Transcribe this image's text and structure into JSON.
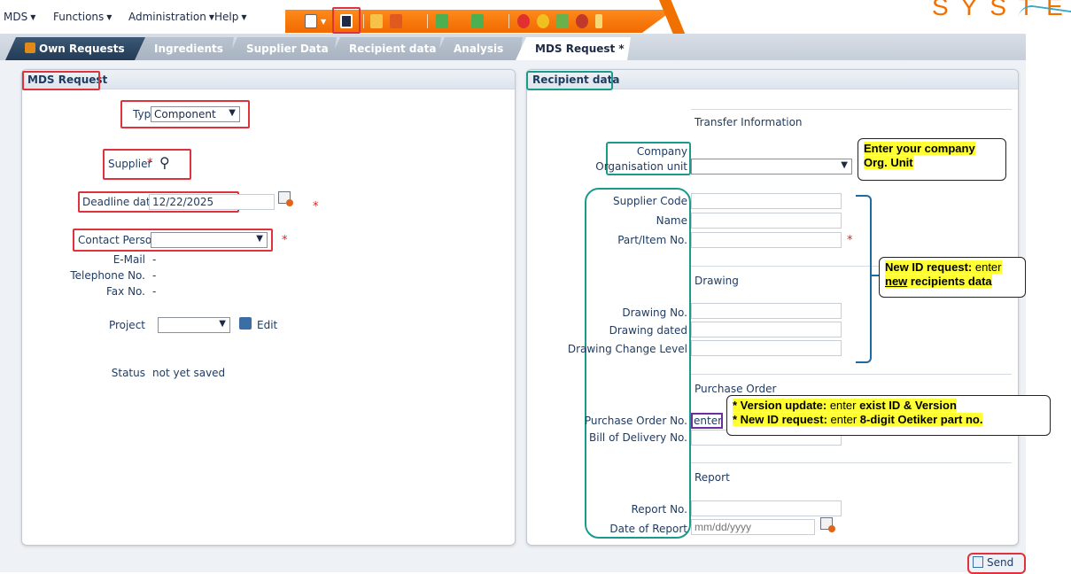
{
  "menu": [
    {
      "label": "MDS"
    },
    {
      "label": "Functions"
    },
    {
      "label": "Administration"
    },
    {
      "label": "Help"
    }
  ],
  "brand_text": "SYSTE",
  "tabs": [
    {
      "label": "Own Requests",
      "state": "dark"
    },
    {
      "label": "Ingredients",
      "state": "disabled"
    },
    {
      "label": "Supplier Data",
      "state": "disabled"
    },
    {
      "label": "Recipient data",
      "state": "disabled"
    },
    {
      "label": "Analysis",
      "state": "disabled"
    },
    {
      "label": "MDS Request *",
      "state": "active"
    }
  ],
  "left_panel": {
    "title": "MDS Request",
    "type_label": "Type",
    "type_value": "Component",
    "supplier_label": "Supplier",
    "deadline_label": "Deadline date",
    "deadline_value": "12/22/2025",
    "contact_label": "Contact Person",
    "contact_value": "",
    "email_label": "E-Mail",
    "email_value": "-",
    "phone_label": "Telephone No.",
    "phone_value": "-",
    "fax_label": "Fax No.",
    "fax_value": "-",
    "project_label": "Project",
    "project_value": "",
    "edit_label": "Edit",
    "status_label": "Status",
    "status_value": "not yet saved",
    "required_mark": "*"
  },
  "right_panel": {
    "title": "Recipient data",
    "transfer_heading": "Transfer Information",
    "company_label": "Company",
    "org_unit_label": "Organisation unit",
    "org_unit_value": "",
    "supplier_code_label": "Supplier Code",
    "name_label": "Name",
    "part_no_label": "Part/Item No.",
    "drawing_heading": "Drawing",
    "drawing_no_label": "Drawing No.",
    "drawing_dated_label": "Drawing dated",
    "drawing_change_label": "Drawing Change Level",
    "purchase_heading": "Purchase Order",
    "po_no_label": "Purchase Order No.",
    "po_no_value": "enter*",
    "bill_label": "Bill of Delivery No.",
    "report_heading": "Report",
    "report_no_label": "Report No.",
    "report_date_label": "Date of Report",
    "report_date_placeholder": "mm/dd/yyyy",
    "required_mark": "*"
  },
  "callouts": {
    "company": {
      "line1": "Enter your company",
      "line2": "Org. Unit"
    },
    "new_id": {
      "bold": "New ID request:",
      "rest": " enter",
      "underlined": "new",
      "line2_rest": " recipients data"
    },
    "po": {
      "l1_star": "* ",
      "l1_bold": "Version update:",
      "l1_mid": " enter ",
      "l1_bold2": "exist ID & Version",
      "l2_star": "* ",
      "l2_bold": "New ID request:",
      "l2_mid": " enter ",
      "l2_bold2": "8-digit Oetiker part no."
    }
  },
  "send_label": "Send",
  "colors": {
    "accent_orange": "#f07000",
    "annotation_red": "#e0323c",
    "annotation_teal": "#1a9a8a",
    "highlight_yellow": "#ffff33",
    "label_blue": "#1e3a5f"
  }
}
